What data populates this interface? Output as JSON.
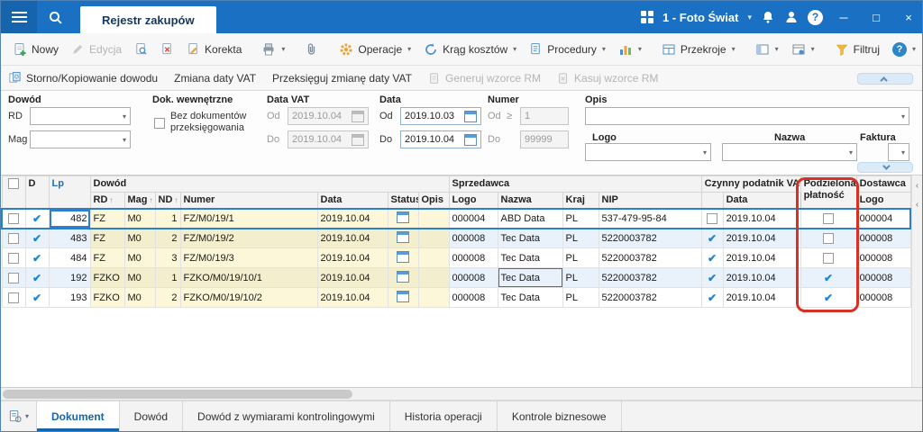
{
  "titlebar": {
    "tab": "Rejestr zakupów",
    "company": "1 - Foto Świat"
  },
  "toolbar": {
    "nowy": "Nowy",
    "edycja": "Edycja",
    "korekta": "Korekta",
    "operacje": "Operacje",
    "krag_kosztow": "Krąg kosztów",
    "procedury": "Procedury",
    "przekroje": "Przekroje",
    "filtruj": "Filtruj"
  },
  "toolbar2": {
    "storno": "Storno/Kopiowanie dowodu",
    "zmiana_daty_vat": "Zmiana daty VAT",
    "przeksieguj": "Przeksięguj zmianę daty VAT",
    "generuj_rm": "Generuj wzorce RM",
    "kasuj_rm": "Kasuj wzorce RM"
  },
  "filters": {
    "dowod": "Dowód",
    "rd": "RD",
    "mag": "Mag",
    "dok_wewnetrzne": "Dok. wewnętrzne",
    "bez_dokumentow_1": "Bez dokumentów",
    "bez_dokumentow_2": "przeksięgowania",
    "data_vat": "Data VAT",
    "data": "Data",
    "numer": "Numer",
    "opis": "Opis",
    "logo": "Logo",
    "nazwa": "Nazwa",
    "faktura": "Faktura",
    "od": "Od",
    "do": "Do",
    "data_vat_od": "2019.10.04",
    "data_vat_do": "2019.10.04",
    "data_od": "2019.10.03",
    "data_do": "2019.10.04",
    "numer_od": "1",
    "numer_do": "99999"
  },
  "grid": {
    "groups": {
      "dowod": "Dowód",
      "sprzedawca": "Sprzedawca",
      "vat": "Czynny podatnik VAT",
      "podzielona_1": "Podzielona",
      "podzielona_2": "płatność",
      "dostawca": "Dostawca"
    },
    "cols": {
      "d": "D",
      "lp": "Lp",
      "rd": "RD",
      "mag": "Mag",
      "nd": "ND",
      "numer": "Numer",
      "data": "Data",
      "status": "Status",
      "opis": "Opis",
      "logo": "Logo",
      "nazwa": "Nazwa",
      "kraj": "Kraj",
      "nip": "NIP",
      "vat_data": "Data",
      "dost_logo": "Logo"
    },
    "rows": [
      {
        "d": true,
        "lp": "482",
        "rd": "FZ",
        "mag": "M0",
        "nd": "1",
        "numer": "FZ/M0/19/1",
        "data": "2019.10.04",
        "logo": "000004",
        "nazwa": "ABD Data",
        "kraj": "PL",
        "nip": "537-479-95-84",
        "vat": false,
        "vat_data": "2019.10.04",
        "podzielona": false,
        "dost_logo": "000004",
        "selected": true,
        "focus": "lp"
      },
      {
        "d": true,
        "lp": "483",
        "rd": "FZ",
        "mag": "M0",
        "nd": "2",
        "numer": "FZ/M0/19/2",
        "data": "2019.10.04",
        "logo": "000008",
        "nazwa": "Tec Data",
        "kraj": "PL",
        "nip": "5220003782",
        "vat": true,
        "vat_data": "2019.10.04",
        "podzielona": false,
        "dost_logo": "000008"
      },
      {
        "d": true,
        "lp": "484",
        "rd": "FZ",
        "mag": "M0",
        "nd": "3",
        "numer": "FZ/M0/19/3",
        "data": "2019.10.04",
        "logo": "000008",
        "nazwa": "Tec Data",
        "kraj": "PL",
        "nip": "5220003782",
        "vat": true,
        "vat_data": "2019.10.04",
        "podzielona": false,
        "dost_logo": "000008"
      },
      {
        "d": true,
        "lp": "192",
        "rd": "FZKO",
        "mag": "M0",
        "nd": "1",
        "numer": "FZKO/M0/19/10/1",
        "data": "2019.10.04",
        "logo": "000008",
        "nazwa": "Tec Data",
        "kraj": "PL",
        "nip": "5220003782",
        "vat": true,
        "vat_data": "2019.10.04",
        "podzielona": true,
        "dost_logo": "000008",
        "focus": "nazwa"
      },
      {
        "d": true,
        "lp": "193",
        "rd": "FZKO",
        "mag": "M0",
        "nd": "2",
        "numer": "FZKO/M0/19/10/2",
        "data": "2019.10.04",
        "logo": "000008",
        "nazwa": "Tec Data",
        "kraj": "PL",
        "nip": "5220003782",
        "vat": true,
        "vat_data": "2019.10.04",
        "podzielona": true,
        "dost_logo": "000008"
      }
    ]
  },
  "bottom_tabs": {
    "items": [
      "Dokument",
      "Dowód",
      "Dowód z wymiarami kontrolingowymi",
      "Historia operacji",
      "Kontrole biznesowe"
    ],
    "active": "Dokument"
  },
  "glyphs": {
    "caret": "▾",
    "sort_asc": "↑",
    "gte": "≥",
    "check": "✔",
    "help": "?",
    "minimize": "─",
    "maximize": "□",
    "close": "×",
    "chevron_left": "‹"
  },
  "colors": {
    "titlebar": "#1a70c2",
    "accent": "#1b87d4",
    "annotation": "#d93025",
    "row_alt": "#e9f1fa",
    "dowod_cells": "#fbf7d8"
  }
}
